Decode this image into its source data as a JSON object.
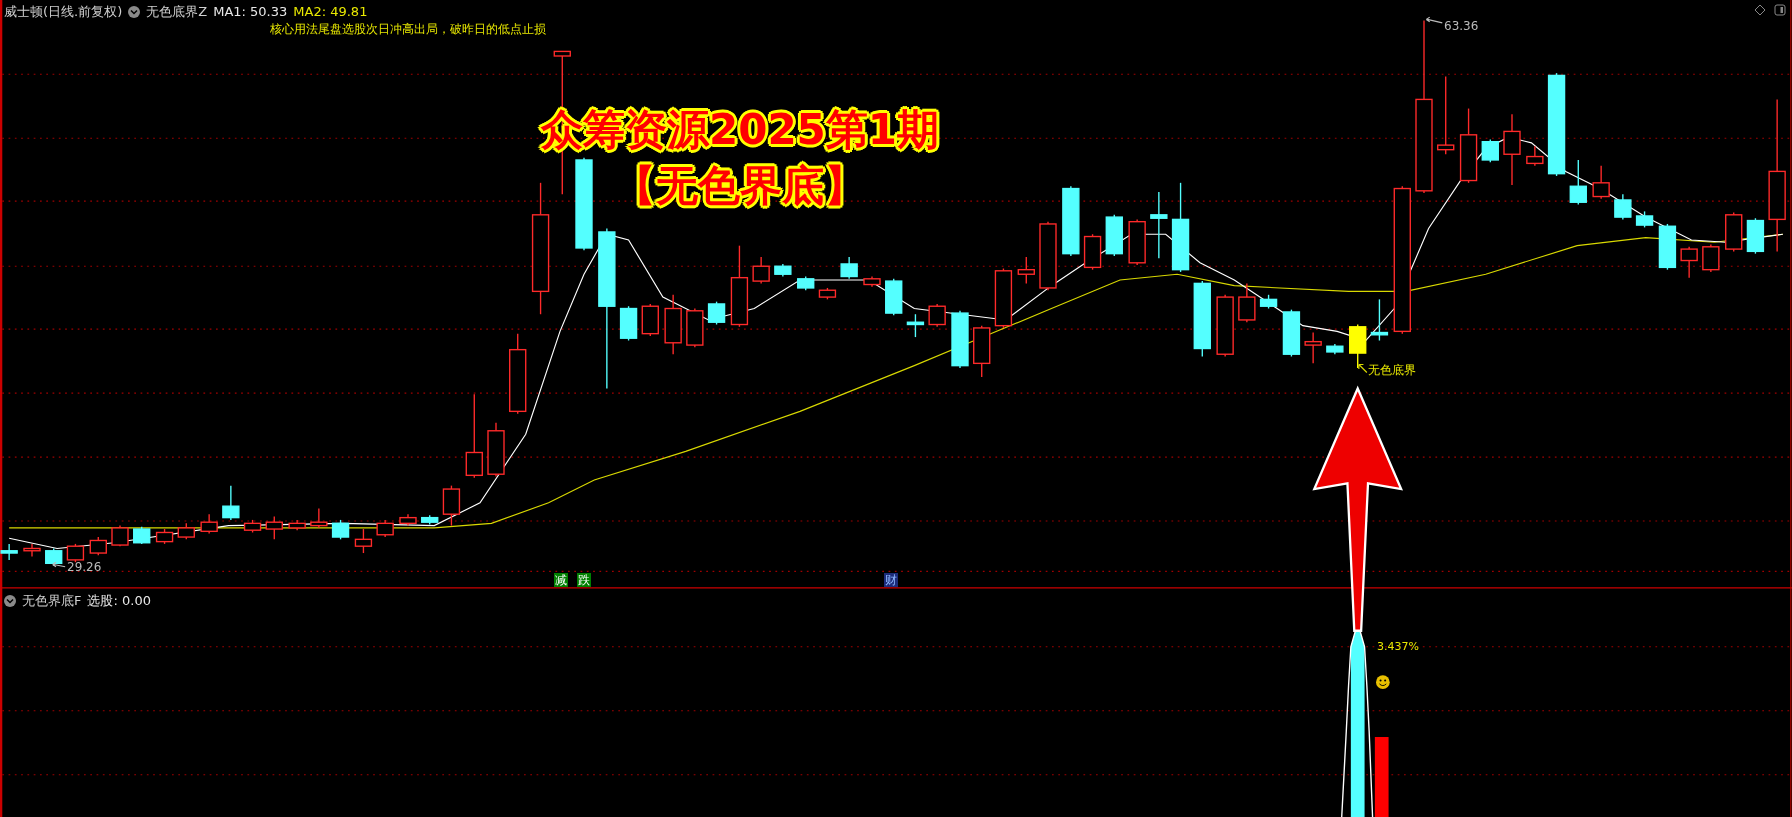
{
  "header": {
    "title": "威士顿(日线.前复权)",
    "indicator": "无色底界Z",
    "ma1": "MA1: 50.33",
    "ma2": "MA2: 49.81"
  },
  "note": "核心用法尾盘选股次日冲高出局，破昨日的低点止损",
  "overlay_title": {
    "line1": "众筹资源2025第1期",
    "line2": "【无色界底】"
  },
  "price_labels": {
    "high": "63.36",
    "low": "29.26"
  },
  "signal_label": "无色底界",
  "markers": [
    {
      "text": "减",
      "color": "#008000"
    },
    {
      "text": "跌",
      "color": "#008000"
    },
    {
      "text": "财",
      "color": "#1c2c7a"
    }
  ],
  "lower_panel": {
    "indicator": "无色界底F",
    "reading": "选股: 0.00",
    "value_label": "3.437%"
  }
}
